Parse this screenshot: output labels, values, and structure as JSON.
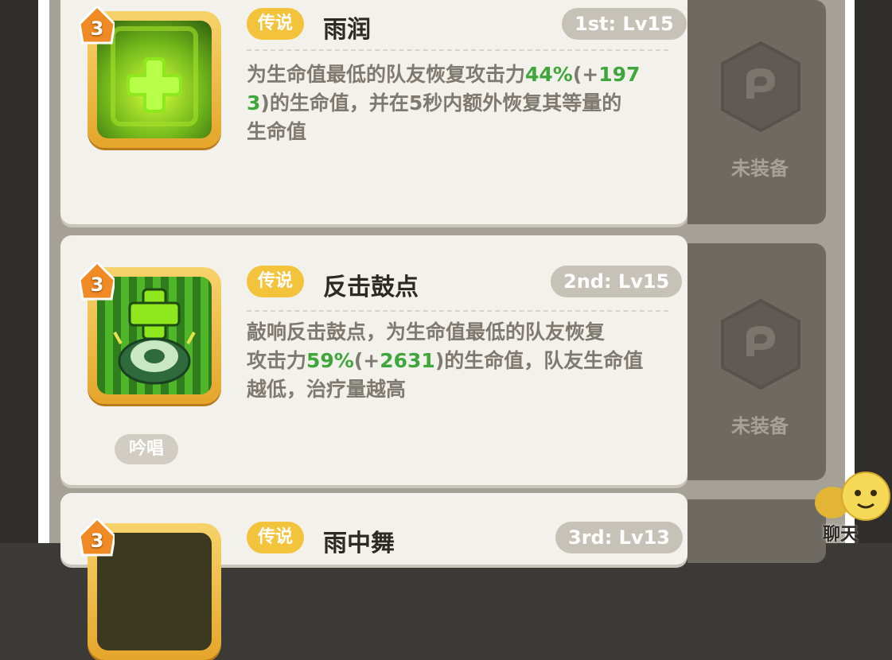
{
  "skills": [
    {
      "rank_badge": "3",
      "rarity": "传说",
      "name": "雨润",
      "level": "1st: Lv15",
      "desc_a": "为生命值最低的队友恢复攻击力",
      "desc_pct": "44%",
      "desc_bonus_open": "(+",
      "desc_bonus_1": "197",
      "desc_bonus_2": "3",
      "desc_bonus_close": ")",
      "desc_b": "的生命值，并在5秒内额外恢复其等量的",
      "desc_c": "生命值",
      "equip_status": "未装备"
    },
    {
      "rank_badge": "3",
      "rarity": "传说",
      "name": "反击鼓点",
      "level": "2nd: Lv15",
      "desc_a": "敲响反击鼓点，为生命值最低的队友恢复",
      "desc_b1": "攻击力",
      "desc_pct": "59%",
      "desc_bonus_open": "(+",
      "desc_bonus": "2631",
      "desc_bonus_close": ")",
      "desc_b2": "的生命值，队友生命值",
      "desc_c": "越低，治疗量越高",
      "tag": "吟唱",
      "equip_status": "未装备"
    },
    {
      "rank_badge": "3",
      "rarity": "传说",
      "name": "雨中舞",
      "level": "3rd: Lv13"
    }
  ],
  "chat": {
    "label": "聊天"
  },
  "colors": {
    "legend": "#f2c33b",
    "value_green": "#3ea63a"
  }
}
